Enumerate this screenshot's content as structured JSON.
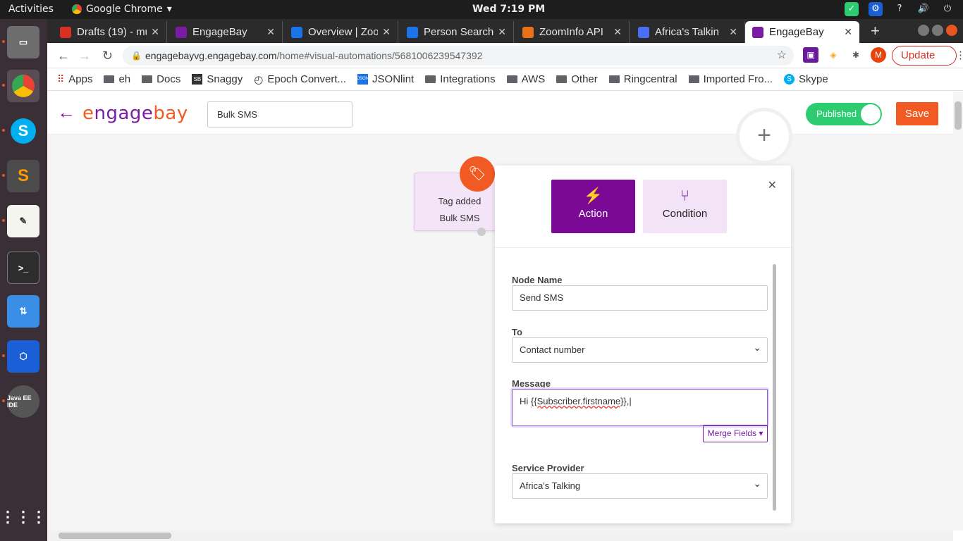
{
  "system_bar": {
    "activities": "Activities",
    "app_name": "Google Chrome",
    "clock": "Wed  7:19 PM",
    "tray_question": "?"
  },
  "tabs": [
    {
      "label": "Drafts (19) - mu",
      "color": "#d93025"
    },
    {
      "label": "EngageBay",
      "color": "#7a1ca3"
    },
    {
      "label": "Overview | Zoo",
      "color": "#1a73e8"
    },
    {
      "label": "Person Search",
      "color": "#1a73e8"
    },
    {
      "label": "ZoomInfo API",
      "color": "#e8711a"
    },
    {
      "label": "Africa's Talkin",
      "color": "#4c6ef5"
    },
    {
      "label": "EngageBay",
      "color": "#7a1ca3"
    }
  ],
  "address_bar": {
    "host": "engagebayvg.engagebay.com",
    "path": "/home#visual-automations/5681006239547392"
  },
  "update_button": "Update",
  "profile_initial": "M",
  "bookmarks": [
    {
      "label": "Apps",
      "icon": "apps-grid-icon"
    },
    {
      "label": "eh",
      "icon": "folder-icon"
    },
    {
      "label": "Docs",
      "icon": "folder-icon"
    },
    {
      "label": "Snaggy",
      "icon": "sb-icon"
    },
    {
      "label": "Epoch Convert...",
      "icon": "clock-icon"
    },
    {
      "label": "JSONlint",
      "icon": "json-icon"
    },
    {
      "label": "Integrations",
      "icon": "folder-icon"
    },
    {
      "label": "AWS",
      "icon": "folder-icon"
    },
    {
      "label": "Other",
      "icon": "folder-icon"
    },
    {
      "label": "Ringcentral",
      "icon": "folder-icon"
    },
    {
      "label": "Imported Fro...",
      "icon": "folder-icon"
    },
    {
      "label": "Skype",
      "icon": "skype-icon"
    }
  ],
  "app": {
    "logo": {
      "e": "e",
      "rest_purple": "ngage",
      "rest_orange": "bay"
    },
    "automation_name": "Bulk SMS",
    "status_toggle": "Published",
    "save": "Save",
    "brand_color": "#7a1ca3",
    "accent_color": "#f15a22"
  },
  "trigger_node": {
    "title": "Tag added",
    "subtitle": "Bulk SMS"
  },
  "panel": {
    "tabs": {
      "action": "Action",
      "condition": "Condition"
    },
    "node_name_label": "Node Name",
    "node_name_value": "Send SMS",
    "to_label": "To",
    "to_value": "Contact number",
    "message_label": "Message",
    "message_prefix": "Hi ",
    "message_var": "{{Subscriber.firstname}}",
    "message_suffix": ",",
    "merge_fields": "Merge Fields",
    "provider_label": "Service Provider",
    "provider_value": "Africa's Talking"
  }
}
